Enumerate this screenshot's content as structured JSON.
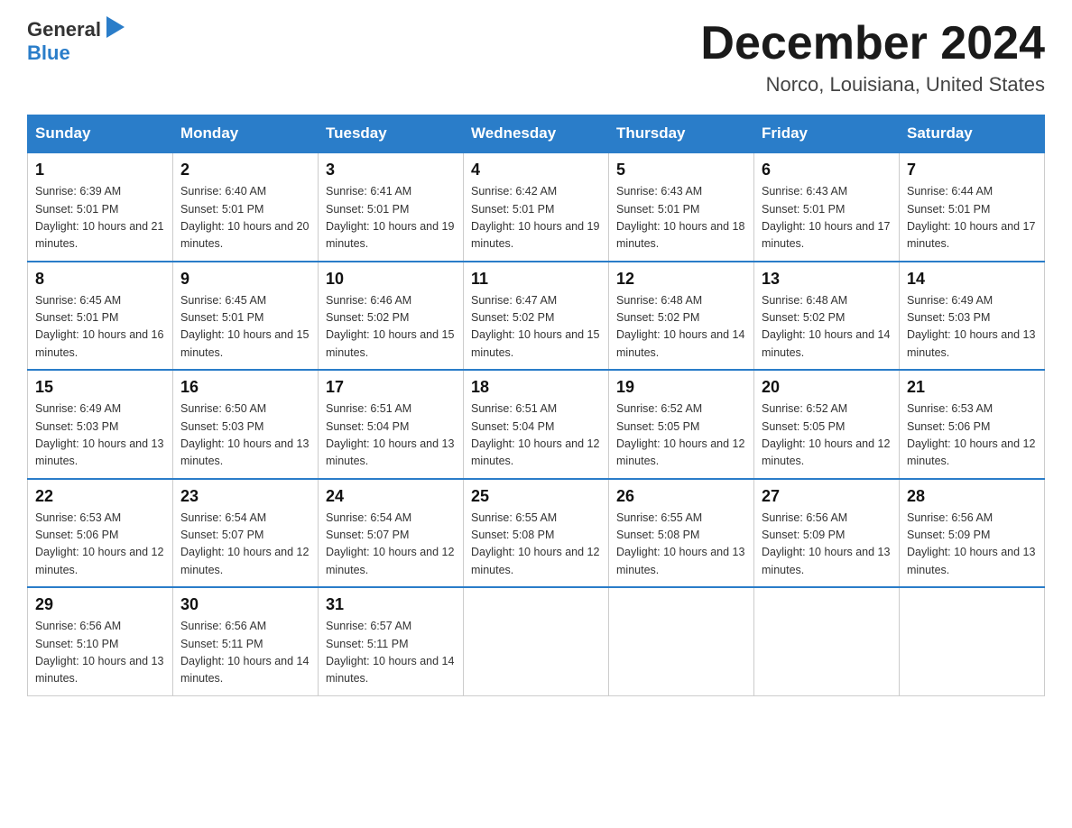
{
  "logo": {
    "text_general": "General",
    "text_blue": "Blue",
    "triangle_symbol": "▶"
  },
  "title": {
    "month": "December 2024",
    "location": "Norco, Louisiana, United States"
  },
  "header_days": [
    "Sunday",
    "Monday",
    "Tuesday",
    "Wednesday",
    "Thursday",
    "Friday",
    "Saturday"
  ],
  "weeks": [
    [
      {
        "day": "1",
        "sunrise": "6:39 AM",
        "sunset": "5:01 PM",
        "daylight": "10 hours and 21 minutes."
      },
      {
        "day": "2",
        "sunrise": "6:40 AM",
        "sunset": "5:01 PM",
        "daylight": "10 hours and 20 minutes."
      },
      {
        "day": "3",
        "sunrise": "6:41 AM",
        "sunset": "5:01 PM",
        "daylight": "10 hours and 19 minutes."
      },
      {
        "day": "4",
        "sunrise": "6:42 AM",
        "sunset": "5:01 PM",
        "daylight": "10 hours and 19 minutes."
      },
      {
        "day": "5",
        "sunrise": "6:43 AM",
        "sunset": "5:01 PM",
        "daylight": "10 hours and 18 minutes."
      },
      {
        "day": "6",
        "sunrise": "6:43 AM",
        "sunset": "5:01 PM",
        "daylight": "10 hours and 17 minutes."
      },
      {
        "day": "7",
        "sunrise": "6:44 AM",
        "sunset": "5:01 PM",
        "daylight": "10 hours and 17 minutes."
      }
    ],
    [
      {
        "day": "8",
        "sunrise": "6:45 AM",
        "sunset": "5:01 PM",
        "daylight": "10 hours and 16 minutes."
      },
      {
        "day": "9",
        "sunrise": "6:45 AM",
        "sunset": "5:01 PM",
        "daylight": "10 hours and 15 minutes."
      },
      {
        "day": "10",
        "sunrise": "6:46 AM",
        "sunset": "5:02 PM",
        "daylight": "10 hours and 15 minutes."
      },
      {
        "day": "11",
        "sunrise": "6:47 AM",
        "sunset": "5:02 PM",
        "daylight": "10 hours and 15 minutes."
      },
      {
        "day": "12",
        "sunrise": "6:48 AM",
        "sunset": "5:02 PM",
        "daylight": "10 hours and 14 minutes."
      },
      {
        "day": "13",
        "sunrise": "6:48 AM",
        "sunset": "5:02 PM",
        "daylight": "10 hours and 14 minutes."
      },
      {
        "day": "14",
        "sunrise": "6:49 AM",
        "sunset": "5:03 PM",
        "daylight": "10 hours and 13 minutes."
      }
    ],
    [
      {
        "day": "15",
        "sunrise": "6:49 AM",
        "sunset": "5:03 PM",
        "daylight": "10 hours and 13 minutes."
      },
      {
        "day": "16",
        "sunrise": "6:50 AM",
        "sunset": "5:03 PM",
        "daylight": "10 hours and 13 minutes."
      },
      {
        "day": "17",
        "sunrise": "6:51 AM",
        "sunset": "5:04 PM",
        "daylight": "10 hours and 13 minutes."
      },
      {
        "day": "18",
        "sunrise": "6:51 AM",
        "sunset": "5:04 PM",
        "daylight": "10 hours and 12 minutes."
      },
      {
        "day": "19",
        "sunrise": "6:52 AM",
        "sunset": "5:05 PM",
        "daylight": "10 hours and 12 minutes."
      },
      {
        "day": "20",
        "sunrise": "6:52 AM",
        "sunset": "5:05 PM",
        "daylight": "10 hours and 12 minutes."
      },
      {
        "day": "21",
        "sunrise": "6:53 AM",
        "sunset": "5:06 PM",
        "daylight": "10 hours and 12 minutes."
      }
    ],
    [
      {
        "day": "22",
        "sunrise": "6:53 AM",
        "sunset": "5:06 PM",
        "daylight": "10 hours and 12 minutes."
      },
      {
        "day": "23",
        "sunrise": "6:54 AM",
        "sunset": "5:07 PM",
        "daylight": "10 hours and 12 minutes."
      },
      {
        "day": "24",
        "sunrise": "6:54 AM",
        "sunset": "5:07 PM",
        "daylight": "10 hours and 12 minutes."
      },
      {
        "day": "25",
        "sunrise": "6:55 AM",
        "sunset": "5:08 PM",
        "daylight": "10 hours and 12 minutes."
      },
      {
        "day": "26",
        "sunrise": "6:55 AM",
        "sunset": "5:08 PM",
        "daylight": "10 hours and 13 minutes."
      },
      {
        "day": "27",
        "sunrise": "6:56 AM",
        "sunset": "5:09 PM",
        "daylight": "10 hours and 13 minutes."
      },
      {
        "day": "28",
        "sunrise": "6:56 AM",
        "sunset": "5:09 PM",
        "daylight": "10 hours and 13 minutes."
      }
    ],
    [
      {
        "day": "29",
        "sunrise": "6:56 AM",
        "sunset": "5:10 PM",
        "daylight": "10 hours and 13 minutes."
      },
      {
        "day": "30",
        "sunrise": "6:56 AM",
        "sunset": "5:11 PM",
        "daylight": "10 hours and 14 minutes."
      },
      {
        "day": "31",
        "sunrise": "6:57 AM",
        "sunset": "5:11 PM",
        "daylight": "10 hours and 14 minutes."
      },
      null,
      null,
      null,
      null
    ]
  ]
}
